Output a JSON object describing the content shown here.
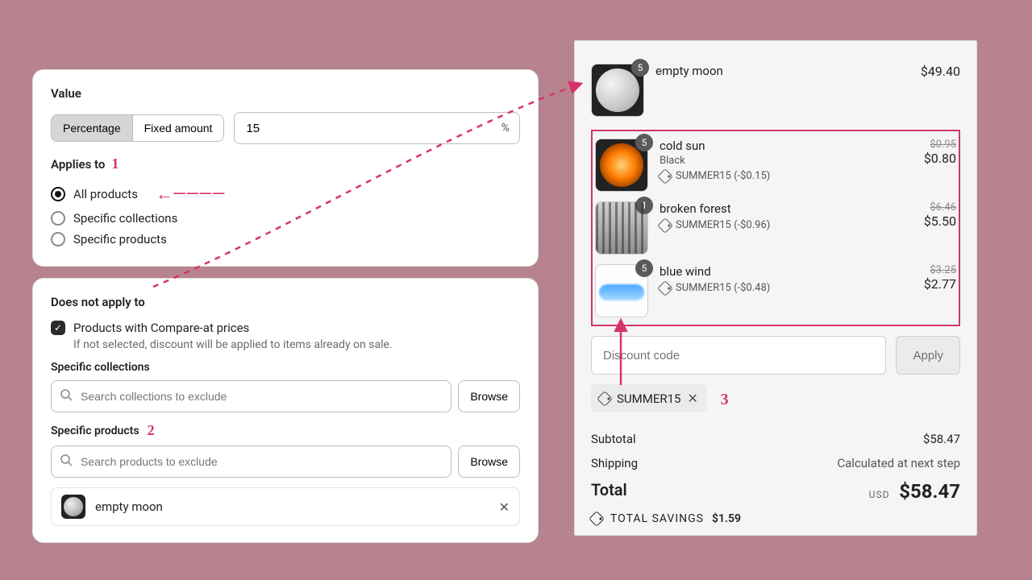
{
  "annotations": {
    "one": "1",
    "two": "2",
    "three": "3"
  },
  "value_card": {
    "title": "Value",
    "percentage_label": "Percentage",
    "fixed_amount_label": "Fixed amount",
    "value": "15",
    "suffix": "%"
  },
  "applies_to": {
    "label": "Applies to",
    "options": {
      "all": "All products",
      "collections": "Specific collections",
      "products": "Specific products"
    },
    "arrow_glyph": "←————"
  },
  "does_not_apply": {
    "title": "Does not apply to",
    "compare_at_label": "Products with Compare-at prices",
    "compare_at_note": "If not selected, discount will be applied to items already on sale.",
    "collections_label": "Specific collections",
    "collections_placeholder": "Search collections to exclude",
    "products_label": "Specific products",
    "products_placeholder": "Search products to exclude",
    "browse_label": "Browse",
    "excluded_item": {
      "name": "empty moon"
    }
  },
  "cart": {
    "items": [
      {
        "title": "empty moon",
        "qty": "5",
        "variant": "",
        "discount": "",
        "orig": "",
        "now": "$49.40",
        "key": "moon"
      },
      {
        "title": "cold sun",
        "qty": "5",
        "variant": "Black",
        "discount": "SUMMER15 (-$0.15)",
        "orig": "$0.95",
        "now": "$0.80",
        "key": "sun"
      },
      {
        "title": "broken forest",
        "qty": "1",
        "variant": "",
        "discount": "SUMMER15 (-$0.96)",
        "orig": "$6.46",
        "now": "$5.50",
        "key": "forest"
      },
      {
        "title": "blue wind",
        "qty": "5",
        "variant": "",
        "discount": "SUMMER15 (-$0.48)",
        "orig": "$3.25",
        "now": "$2.77",
        "key": "wind"
      }
    ],
    "discount_placeholder": "Discount code",
    "apply_label": "Apply",
    "applied_code": "SUMMER15",
    "subtotal_label": "Subtotal",
    "subtotal_value": "$58.47",
    "shipping_label": "Shipping",
    "shipping_value": "Calculated at next step",
    "total_label": "Total",
    "total_currency": "USD",
    "total_value": "$58.47",
    "savings_label": "TOTAL SAVINGS",
    "savings_value": "$1.59"
  }
}
